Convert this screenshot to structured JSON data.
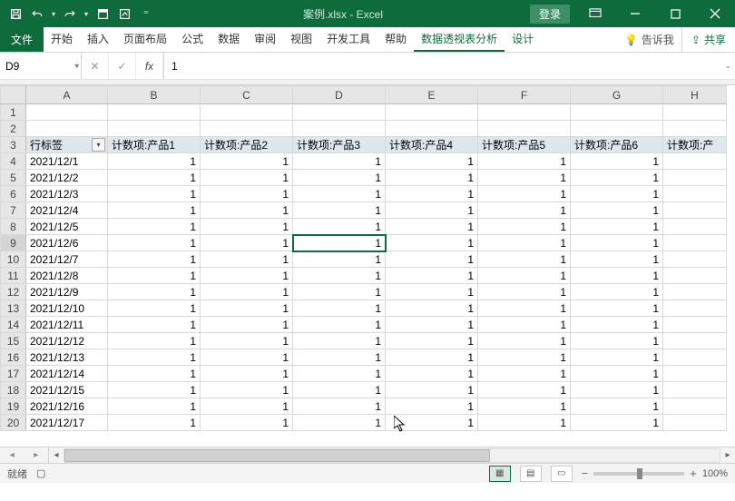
{
  "titlebar": {
    "filename": "案例.xlsx - Excel",
    "login": "登录"
  },
  "ribbon": {
    "file": "文件",
    "tabs": [
      "开始",
      "插入",
      "页面布局",
      "公式",
      "数据",
      "审阅",
      "视图",
      "开发工具",
      "帮助"
    ],
    "ctx_tabs": [
      "数据透视表分析",
      "设计"
    ],
    "tellme": "告诉我",
    "share": "共享"
  },
  "namebox": "D9",
  "formula": "1",
  "columns": [
    "A",
    "B",
    "C",
    "D",
    "E",
    "F",
    "G",
    "H"
  ],
  "pivot": {
    "rowlabel_header": "行标签",
    "value_headers": [
      "计数项:产品1",
      "计数项:产品2",
      "计数项:产品3",
      "计数项:产品4",
      "计数项:产品5",
      "计数项:产品6",
      "计数项:产"
    ],
    "rows": [
      {
        "label": "2021/12/1",
        "v": [
          1,
          1,
          1,
          1,
          1,
          1
        ]
      },
      {
        "label": "2021/12/2",
        "v": [
          1,
          1,
          1,
          1,
          1,
          1
        ]
      },
      {
        "label": "2021/12/3",
        "v": [
          1,
          1,
          1,
          1,
          1,
          1
        ]
      },
      {
        "label": "2021/12/4",
        "v": [
          1,
          1,
          1,
          1,
          1,
          1
        ]
      },
      {
        "label": "2021/12/5",
        "v": [
          1,
          1,
          1,
          1,
          1,
          1
        ]
      },
      {
        "label": "2021/12/6",
        "v": [
          1,
          1,
          1,
          1,
          1,
          1
        ]
      },
      {
        "label": "2021/12/7",
        "v": [
          1,
          1,
          1,
          1,
          1,
          1
        ]
      },
      {
        "label": "2021/12/8",
        "v": [
          1,
          1,
          1,
          1,
          1,
          1
        ]
      },
      {
        "label": "2021/12/9",
        "v": [
          1,
          1,
          1,
          1,
          1,
          1
        ]
      },
      {
        "label": "2021/12/10",
        "v": [
          1,
          1,
          1,
          1,
          1,
          1
        ]
      },
      {
        "label": "2021/12/11",
        "v": [
          1,
          1,
          1,
          1,
          1,
          1
        ]
      },
      {
        "label": "2021/12/12",
        "v": [
          1,
          1,
          1,
          1,
          1,
          1
        ]
      },
      {
        "label": "2021/12/13",
        "v": [
          1,
          1,
          1,
          1,
          1,
          1
        ]
      },
      {
        "label": "2021/12/14",
        "v": [
          1,
          1,
          1,
          1,
          1,
          1
        ]
      },
      {
        "label": "2021/12/15",
        "v": [
          1,
          1,
          1,
          1,
          1,
          1
        ]
      },
      {
        "label": "2021/12/16",
        "v": [
          1,
          1,
          1,
          1,
          1,
          1
        ]
      },
      {
        "label": "2021/12/17",
        "v": [
          1,
          1,
          1,
          1,
          1,
          1
        ]
      }
    ]
  },
  "status": {
    "ready": "就绪",
    "zoom": "100%"
  },
  "active_cell": {
    "row": 9,
    "col": "D"
  }
}
